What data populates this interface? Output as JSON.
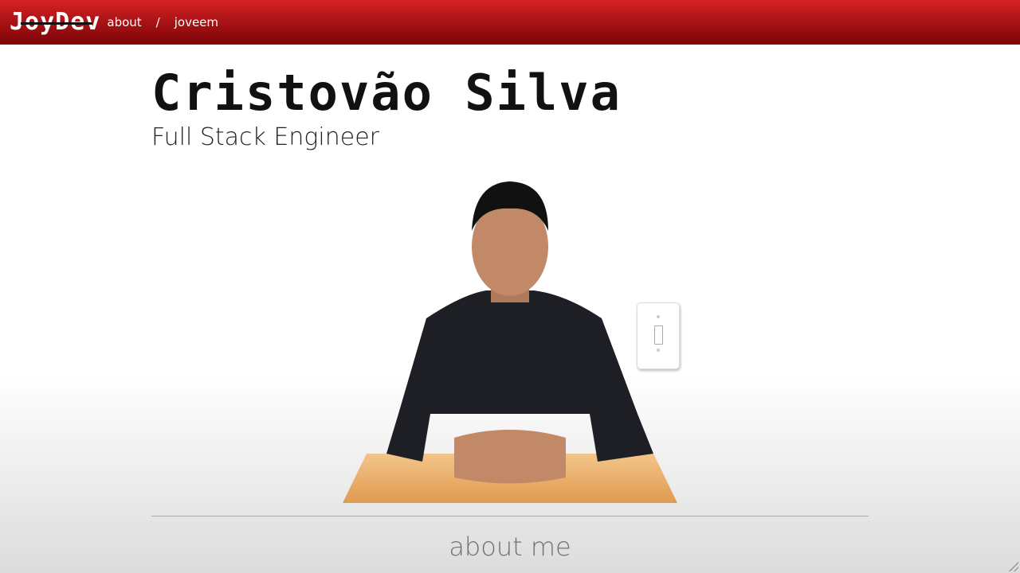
{
  "header": {
    "logo": "JoyDev",
    "nav": [
      {
        "label": "about"
      },
      {
        "label": "/"
      },
      {
        "label": "joveem"
      }
    ]
  },
  "hero": {
    "name": "Cristovão Silva",
    "role": "Full Stack Engineer",
    "photo_alt": "portrait at desk"
  },
  "section": {
    "title": "about me"
  },
  "colors": {
    "header_top": "#d52226",
    "header_bottom": "#7c0405"
  }
}
